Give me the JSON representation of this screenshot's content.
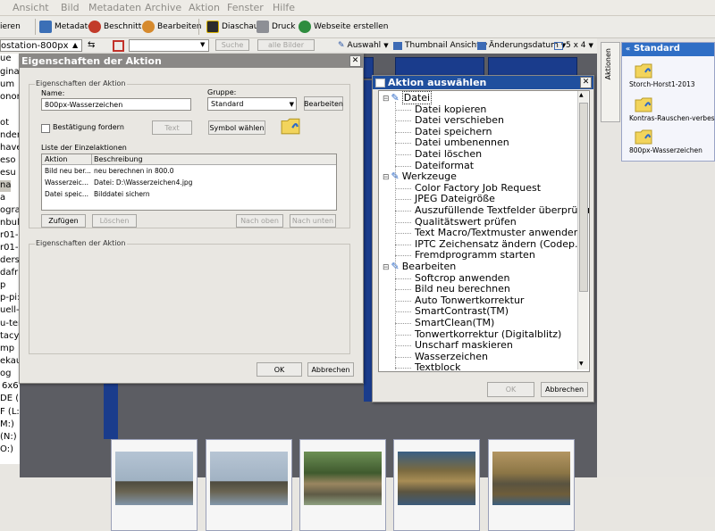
{
  "menubar": [
    "Ansicht",
    "Bild",
    "Metadaten",
    "Archive",
    "Aktion",
    "Fenster",
    "Hilfe"
  ],
  "toolbar": {
    "items": [
      "ieren",
      "Metadaten",
      "Beschnitt",
      "Bearbeiten",
      "Diaschau",
      "Druck",
      "Webseite erstellen"
    ],
    "left_field": "ostation-800px"
  },
  "toolbar2": {
    "search_button": "Suche",
    "all_images_button": "alle Bilder",
    "selection_label": "Auswahl",
    "thumbnail_view_label": "Thumbnail Ansicht",
    "sort_label": "Änderungsdatum",
    "grid_label": "5 x 4"
  },
  "left_list": [
    "ue",
    "gina",
    "um",
    "onor",
    "ot",
    "nder",
    "have",
    "eso",
    "esu",
    "na",
    "a",
    "ogra",
    "nbul-",
    "r01-",
    "r01-",
    "ders",
    "dafri",
    "p",
    "p-pi:",
    "uell-I",
    "u-ter",
    "tacy",
    "mp",
    "ekauf",
    "og",
    "6x6",
    "DE (K:)",
    "F (L:)",
    "M:)",
    "(N:)",
    "O:)"
  ],
  "right_panel": {
    "tab_label": "Aktionen",
    "header": "Standard",
    "items": [
      "Storch-Horst1-2013",
      "Kontras-Rauschen-verbess",
      "800px-Wasserzeichen"
    ]
  },
  "dialog_props": {
    "title": "Eigenschaften der Aktion",
    "group_label": "Eigenschaften der Aktion",
    "name_label": "Name:",
    "name_value": "800px-Wasserzeichen",
    "group_field_label": "Gruppe:",
    "group_value": "Standard",
    "edit_button": "Bearbeiten",
    "confirm_label": "Bestätigung fordern",
    "text_button": "Text",
    "symbol_button": "Symbol wählen",
    "list_label": "Liste der Einzelaktionen",
    "columns": [
      "Aktion",
      "Beschreibung"
    ],
    "rows": [
      [
        "Bild neu ber...",
        "neu berechnen in 800.0"
      ],
      [
        "Wasserzeic...",
        "Datei: D:\\Wasserzeichen4.jpg"
      ],
      [
        "Datei speic...",
        "Bilddatei sichern"
      ]
    ],
    "add_button": "Zufügen",
    "delete_button": "Löschen",
    "up_button": "Nach oben",
    "down_button": "Nach unten",
    "props_group_label": "Eigenschaften der Aktion",
    "ok_button": "OK",
    "cancel_button": "Abbrechen"
  },
  "dialog_select": {
    "title": "Aktion auswählen",
    "tree": [
      {
        "label": "Datei",
        "level": 0,
        "expanded": true,
        "selected": true
      },
      {
        "label": "Datei kopieren",
        "level": 1
      },
      {
        "label": "Datei verschieben",
        "level": 1
      },
      {
        "label": "Datei speichern",
        "level": 1
      },
      {
        "label": "Datei umbenennen",
        "level": 1
      },
      {
        "label": "Datei löschen",
        "level": 1
      },
      {
        "label": "Dateiformat",
        "level": 1
      },
      {
        "label": "Werkzeuge",
        "level": 0,
        "expanded": true
      },
      {
        "label": "Color Factory Job Request",
        "level": 1
      },
      {
        "label": "JPEG Dateigröße",
        "level": 1
      },
      {
        "label": "Auszufüllende Textfelder überprüfen",
        "level": 1
      },
      {
        "label": "Qualitätswert prüfen",
        "level": 1
      },
      {
        "label": "Text Macro/Textmuster anwenden",
        "level": 1
      },
      {
        "label": "IPTC Zeichensatz ändern (Codep...",
        "level": 1
      },
      {
        "label": "Fremdprogramm starten",
        "level": 1
      },
      {
        "label": "Bearbeiten",
        "level": 0,
        "expanded": true
      },
      {
        "label": "Softcrop anwenden",
        "level": 1
      },
      {
        "label": "Bild neu berechnen",
        "level": 1
      },
      {
        "label": "Auto Tonwertkorrektur",
        "level": 1
      },
      {
        "label": "SmartContrast(TM)",
        "level": 1
      },
      {
        "label": "SmartClean(TM)",
        "level": 1
      },
      {
        "label": "Tonwertkorrektur (Digitalblitz)",
        "level": 1
      },
      {
        "label": "Unscharf maskieren",
        "level": 1
      },
      {
        "label": "Wasserzeichen",
        "level": 1
      },
      {
        "label": "Textblock",
        "level": 1
      }
    ],
    "ok_button": "OK",
    "cancel_button": "Abbrechen"
  },
  "colors": {
    "title_active": "#1f4f9e",
    "title_inactive": "#8a8886",
    "panel_header": "#2f6ec5",
    "thumb_bg": "#5c5d63"
  }
}
